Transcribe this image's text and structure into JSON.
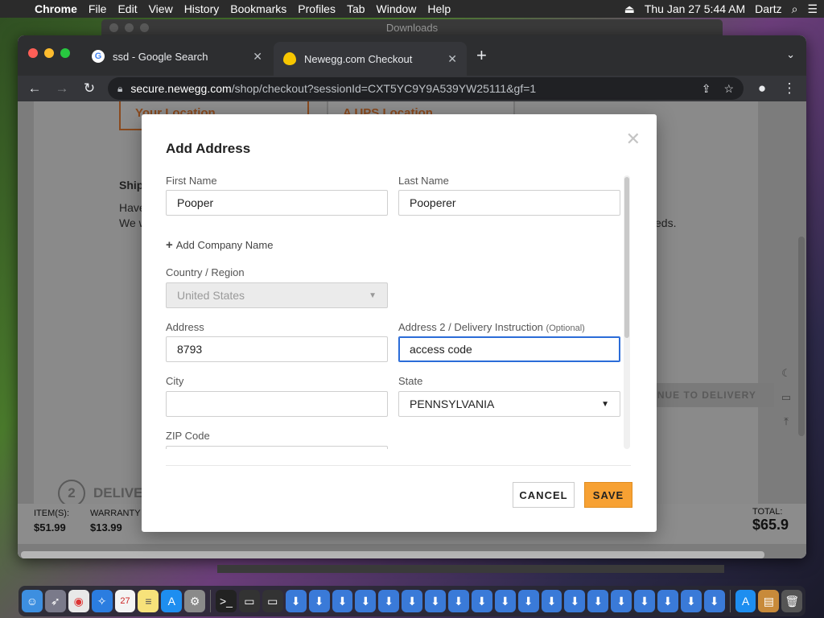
{
  "menubar": {
    "app": "Chrome",
    "items": [
      "File",
      "Edit",
      "View",
      "History",
      "Bookmarks",
      "Profiles",
      "Tab",
      "Window",
      "Help"
    ],
    "datetime": "Thu Jan 27  5:44 AM",
    "user": "Dartz"
  },
  "finder": {
    "title": "Downloads"
  },
  "browser": {
    "tabs": [
      {
        "title": "ssd - Google Search",
        "favicon": "G"
      },
      {
        "title": "Newegg.com Checkout",
        "favicon": "egg"
      }
    ],
    "url_host": "secure.newegg.com",
    "url_path": "/shop/checkout?sessionId=CXT5YC9Y9A539YW25111&gf=1"
  },
  "page": {
    "your_location": "Your Location",
    "ups_location": "A UPS Location",
    "ship_title": "Ship",
    "ship_text1": "Have",
    "ship_text2": "We w",
    "ship_text3": "eds.",
    "continue_label": "TINUE TO DELIVERY",
    "step2_num": "2",
    "step2_label": "DELIVE",
    "summary": {
      "items_label": "ITEM(S):",
      "items_value": "$51.99",
      "warranty_label": "WARRANTY &",
      "warranty_value": "$13.99",
      "total_label": "TOTAL:",
      "total_value": "$65.9"
    }
  },
  "modal": {
    "title": "Add Address",
    "first_name_label": "First Name",
    "first_name_value": "Pooper",
    "last_name_label": "Last Name",
    "last_name_value": "Pooperer",
    "add_company": "Add Company Name",
    "country_label": "Country / Region",
    "country_value": "United States",
    "address_label": "Address",
    "address_value": "8793",
    "address2_label": "Address 2 / Delivery Instruction",
    "address2_optional": "(Optional)",
    "address2_value": "access code",
    "city_label": "City",
    "city_value": "",
    "state_label": "State",
    "state_value": "PENNSYLVANIA",
    "zip_label": "ZIP Code",
    "cancel_label": "CANCEL",
    "save_label": "SAVE"
  },
  "colors": {
    "save_button": "#f7a133",
    "focus_border": "#2b6cd8",
    "location_accent": "#8a4a1e"
  }
}
